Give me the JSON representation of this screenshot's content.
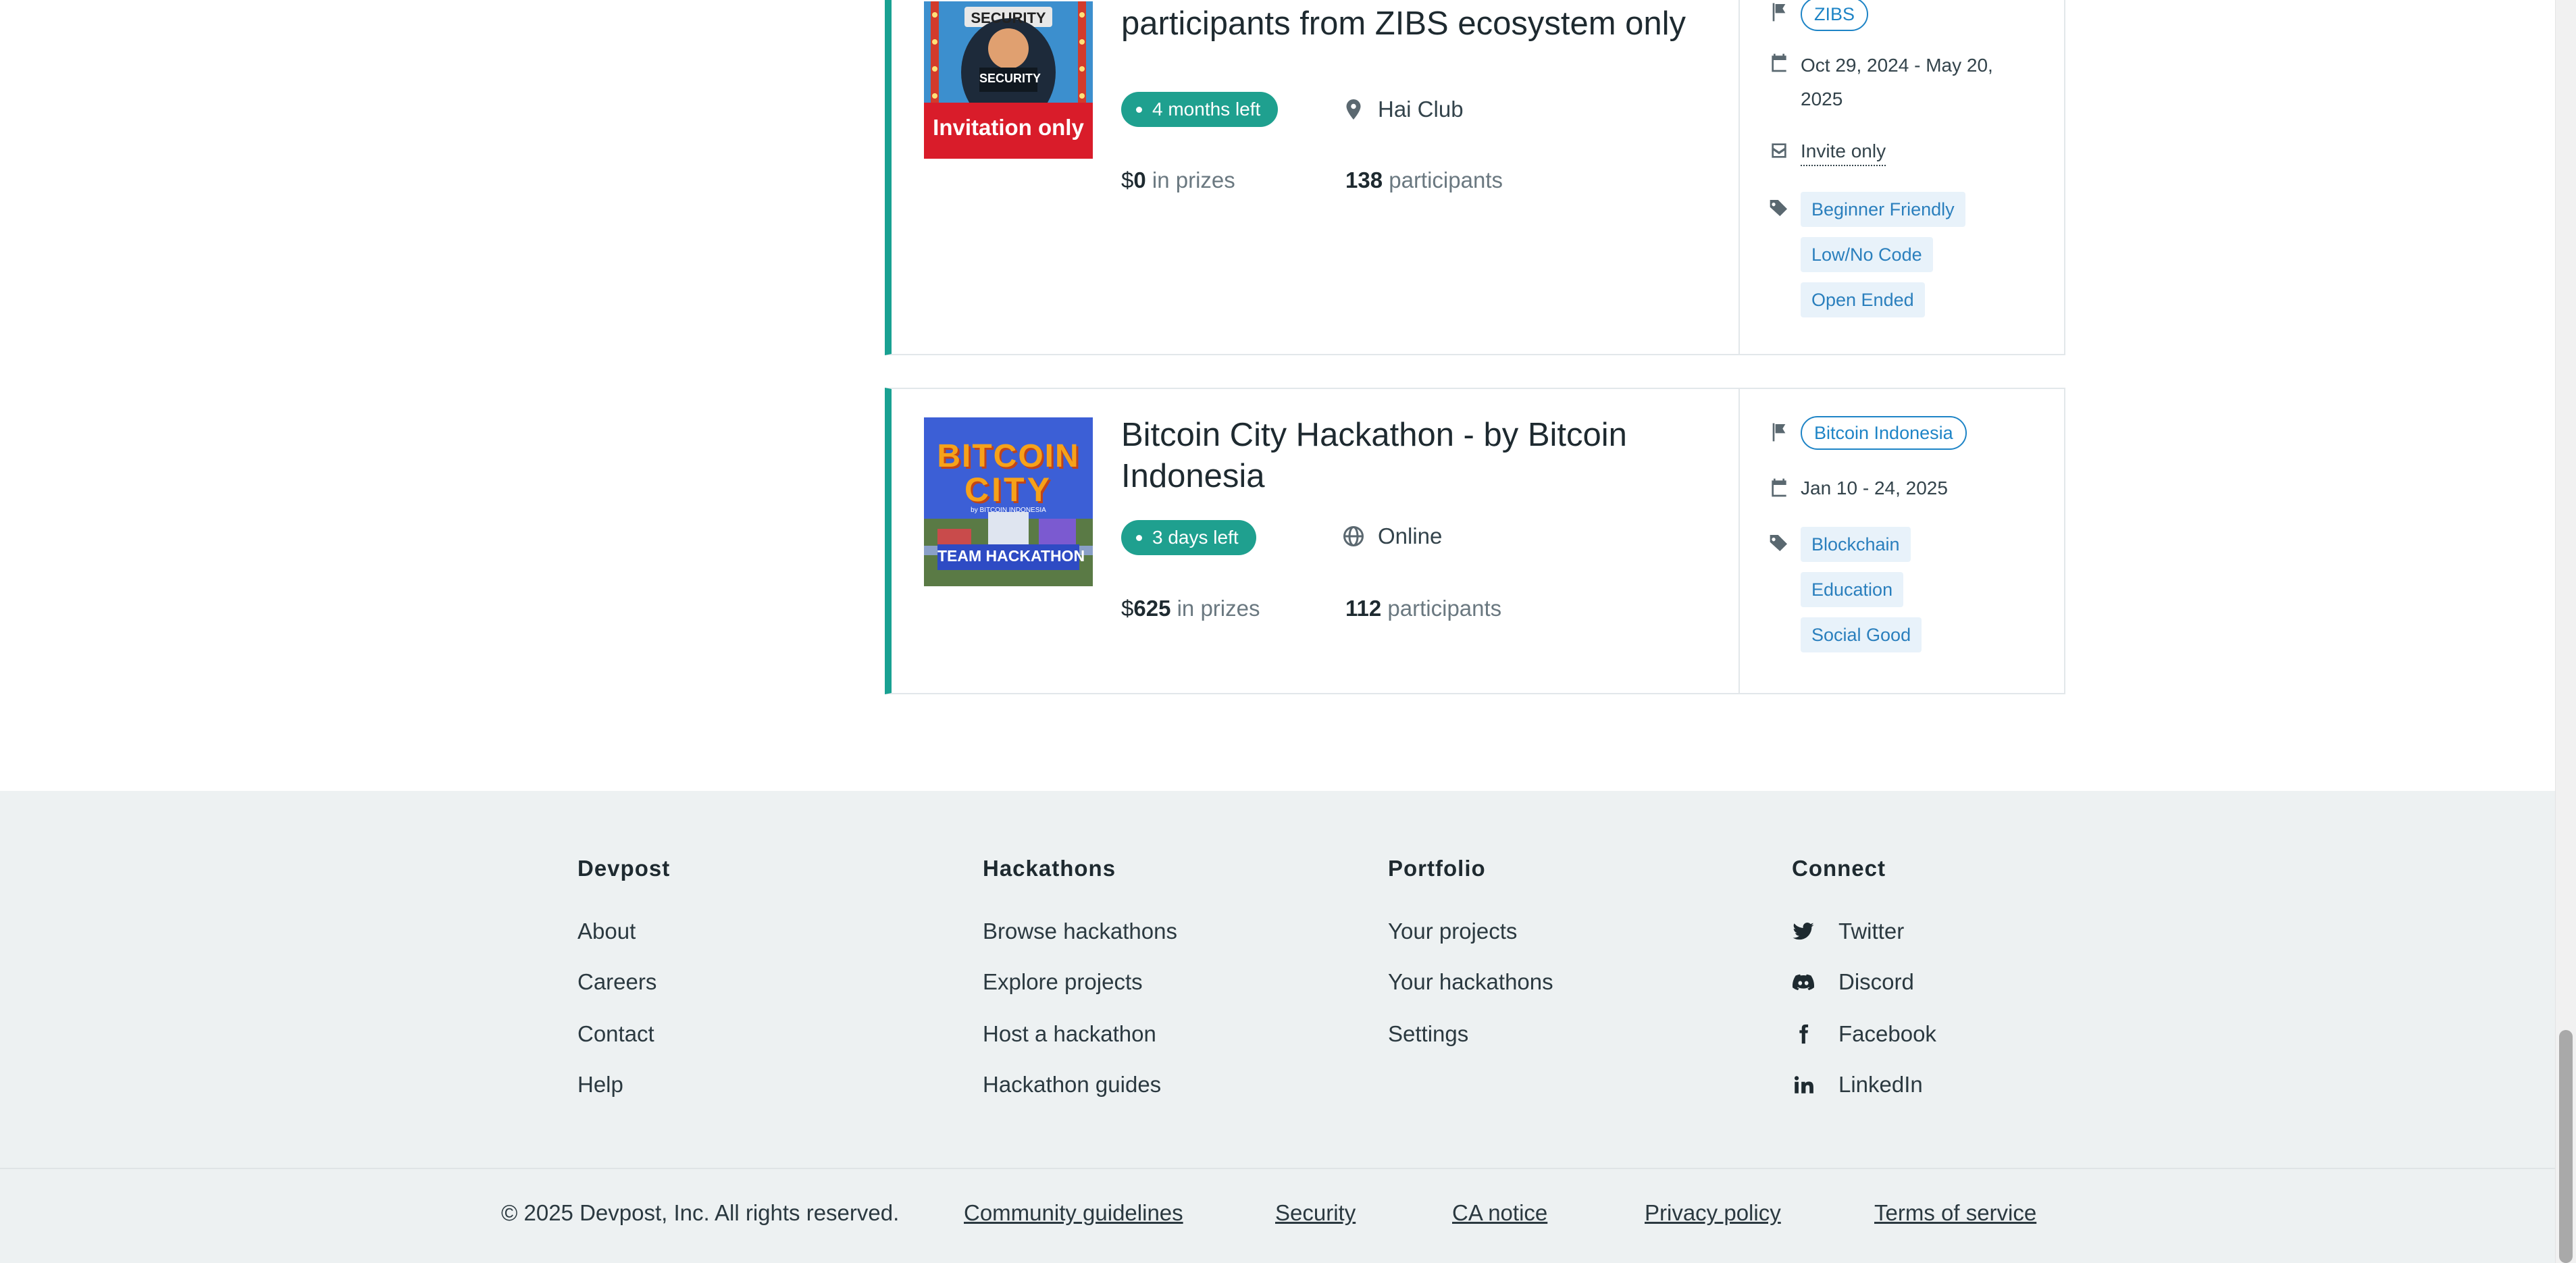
{
  "hackathons": [
    {
      "title": "Startup Program - Invitation only, participants from ZIBS ecosystem only",
      "thumb_top_text": "SECURITY",
      "thumb_sign_text": "SECURITY",
      "thumb_banner": "Invitation only",
      "status": "4 months left",
      "location_icon": "map-pin-icon",
      "location": "Hai Club",
      "prize_currency": "$",
      "prize_amount": "0",
      "prize_suffix": "in prizes",
      "participants_count": "138",
      "participants_label": "participants",
      "host": "ZIBS",
      "dates": "Oct 29, 2024 - May 20, 2025",
      "access": "Invite only",
      "tags": [
        "Beginner Friendly",
        "Low/No Code",
        "Open Ended"
      ]
    },
    {
      "title": "Bitcoin City Hackathon - by Bitcoin Indonesia",
      "thumb_logo_line1": "BITCOIN",
      "thumb_logo_line2": "CITY",
      "thumb_sub": "by BITCOIN INDONESIA",
      "thumb_banner": "TEAM HACKATHON",
      "status": "3 days left",
      "location_icon": "globe-icon",
      "location": "Online",
      "prize_currency": "$",
      "prize_amount": "625",
      "prize_suffix": "in prizes",
      "participants_count": "112",
      "participants_label": "participants",
      "host": "Bitcoin Indonesia",
      "dates": "Jan 10 - 24, 2025",
      "tags": [
        "Blockchain",
        "Education",
        "Social Good"
      ]
    }
  ],
  "footer": {
    "columns": [
      {
        "heading": "Devpost",
        "links": [
          "About",
          "Careers",
          "Contact",
          "Help"
        ]
      },
      {
        "heading": "Hackathons",
        "links": [
          "Browse hackathons",
          "Explore projects",
          "Host a hackathon",
          "Hackathon guides"
        ]
      },
      {
        "heading": "Portfolio",
        "links": [
          "Your projects",
          "Your hackathons",
          "Settings"
        ]
      },
      {
        "heading": "Connect",
        "links": [
          "Twitter",
          "Discord",
          "Facebook",
          "LinkedIn"
        ]
      }
    ],
    "copyright": "© 2025 Devpost, Inc. All rights reserved.",
    "legal_links": [
      "Community guidelines",
      "Security",
      "CA notice",
      "Privacy policy",
      "Terms of service"
    ]
  },
  "colors": {
    "accent": "#19a192",
    "badge": "#1fa08f",
    "link": "#1e84c6",
    "footer_bg": "#edf1f2"
  }
}
